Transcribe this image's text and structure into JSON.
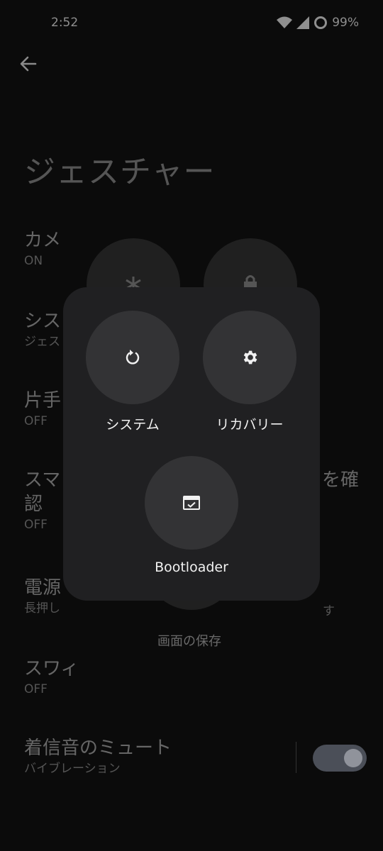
{
  "status_bar": {
    "time": "2:52",
    "battery": "99%"
  },
  "page": {
    "title": "ジェスチャー"
  },
  "settings": [
    {
      "title": "カメ",
      "subtitle": "ON"
    },
    {
      "title": "シス",
      "subtitle": "ジェス"
    },
    {
      "title": "片手",
      "subtitle": "OFF"
    },
    {
      "title": "スマ",
      "title_right": "を確",
      "title_line2": "認",
      "subtitle": "OFF"
    },
    {
      "title": "電源",
      "subtitle": "長押し",
      "subtitle_right": "す"
    },
    {
      "title": "スワィ",
      "subtitle": "OFF"
    },
    {
      "title": "着信音のミュート",
      "subtitle": "バイブレーション"
    }
  ],
  "background_menu": {
    "label": "画面の保存"
  },
  "dialog": {
    "options": [
      {
        "label": "システム",
        "icon": "restart-icon"
      },
      {
        "label": "リカバリー",
        "icon": "gear-icon"
      },
      {
        "label": "Bootloader",
        "icon": "bootloader-window-icon"
      }
    ]
  },
  "colors": {
    "background": "#0b0b0b",
    "dialog": "#202022",
    "option_circle": "#333335"
  }
}
